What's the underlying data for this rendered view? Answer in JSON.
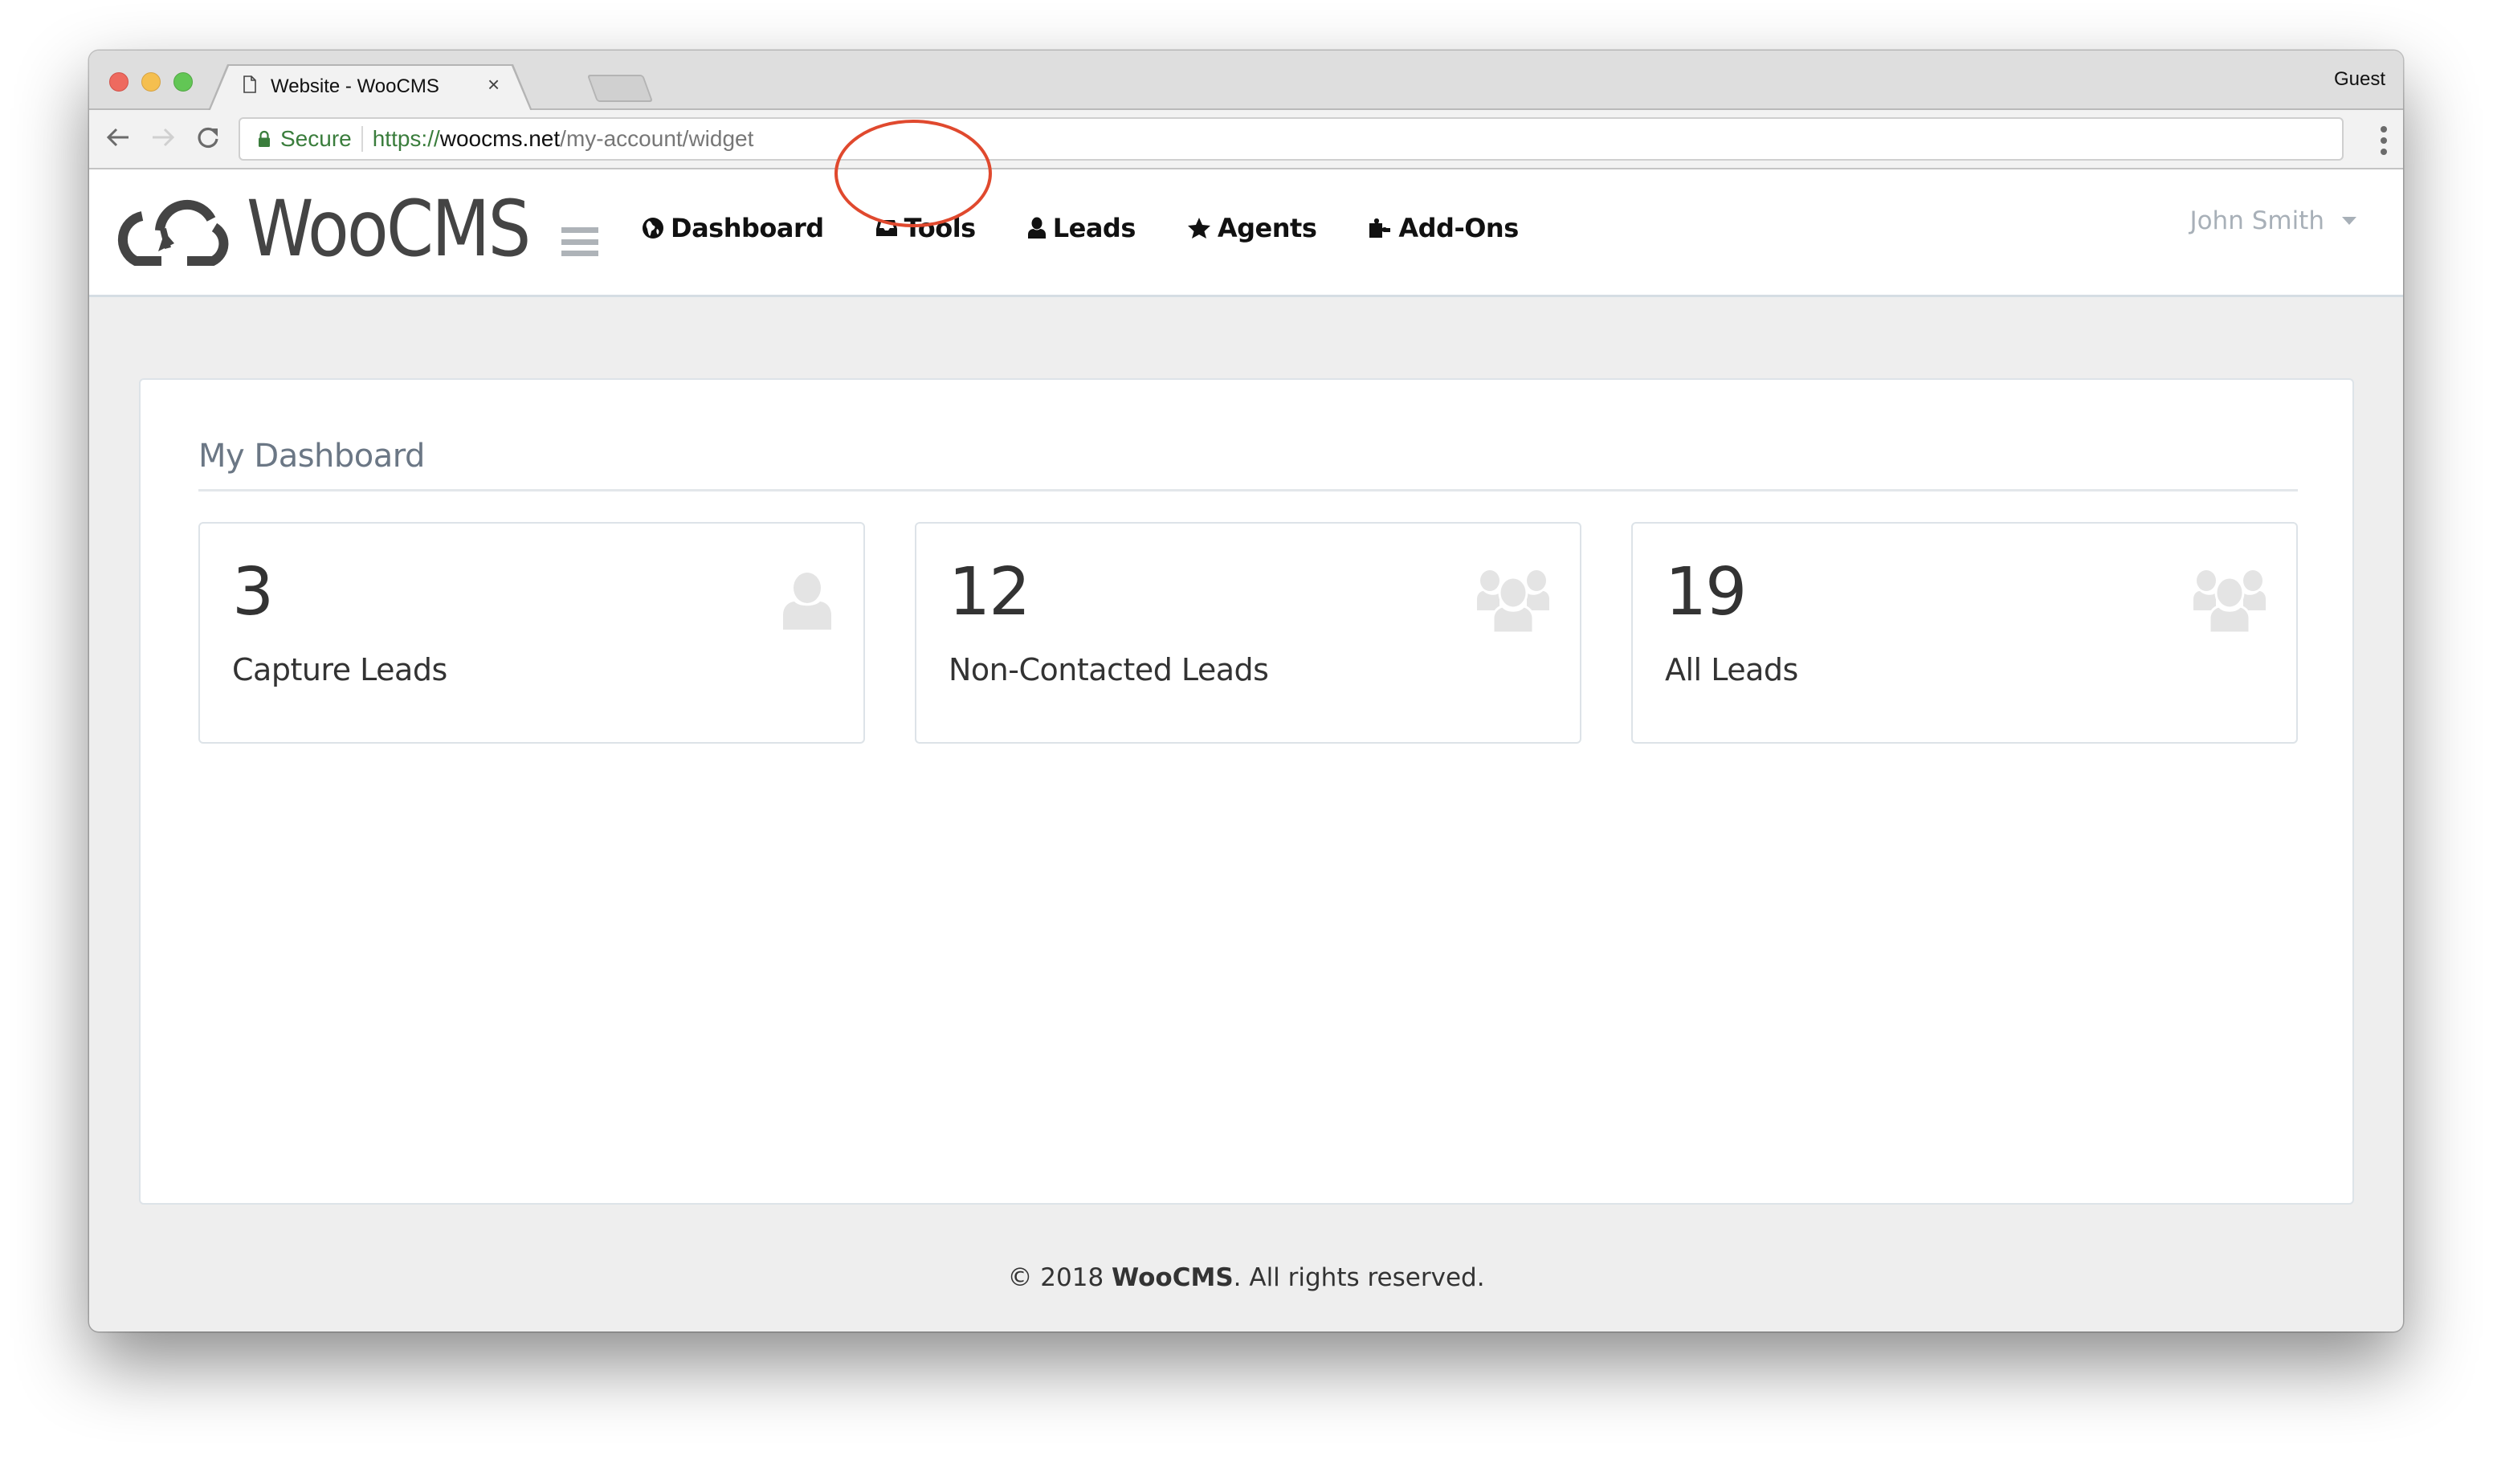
{
  "browser": {
    "tab_title": "Website - WooCMS",
    "tab_close": "×",
    "profile": "Guest",
    "secure_label": "Secure",
    "url_scheme": "https://",
    "url_host": "woocms.net",
    "url_path": "/my-account/widget",
    "icons": {
      "back": "arrow-left-icon",
      "forward": "arrow-right-icon",
      "reload": "reload-icon",
      "lock": "lock-icon",
      "page": "page-icon",
      "menu": "vertical-dots-icon"
    }
  },
  "site": {
    "logo_text": "WooCMS",
    "nav": [
      {
        "label": "Dashboard",
        "icon": "globe-icon"
      },
      {
        "label": "Tools",
        "icon": "inbox-icon",
        "highlighted": true
      },
      {
        "label": "Leads",
        "icon": "user-icon"
      },
      {
        "label": "Agents",
        "icon": "star-icon"
      },
      {
        "label": "Add-Ons",
        "icon": "puzzle-icon"
      }
    ],
    "user_name": "John Smith",
    "accent_color": "#e0492e"
  },
  "dashboard": {
    "title": "My Dashboard",
    "stats": [
      {
        "value": "3",
        "label": "Capture Leads",
        "icon": "user-icon"
      },
      {
        "value": "12",
        "label": "Non-Contacted Leads",
        "icon": "users-icon"
      },
      {
        "value": "19",
        "label": "All Leads",
        "icon": "users-icon"
      }
    ]
  },
  "footer": {
    "prefix": "© 2018 ",
    "brand": "WooCMS",
    "suffix": ". All rights reserved."
  }
}
